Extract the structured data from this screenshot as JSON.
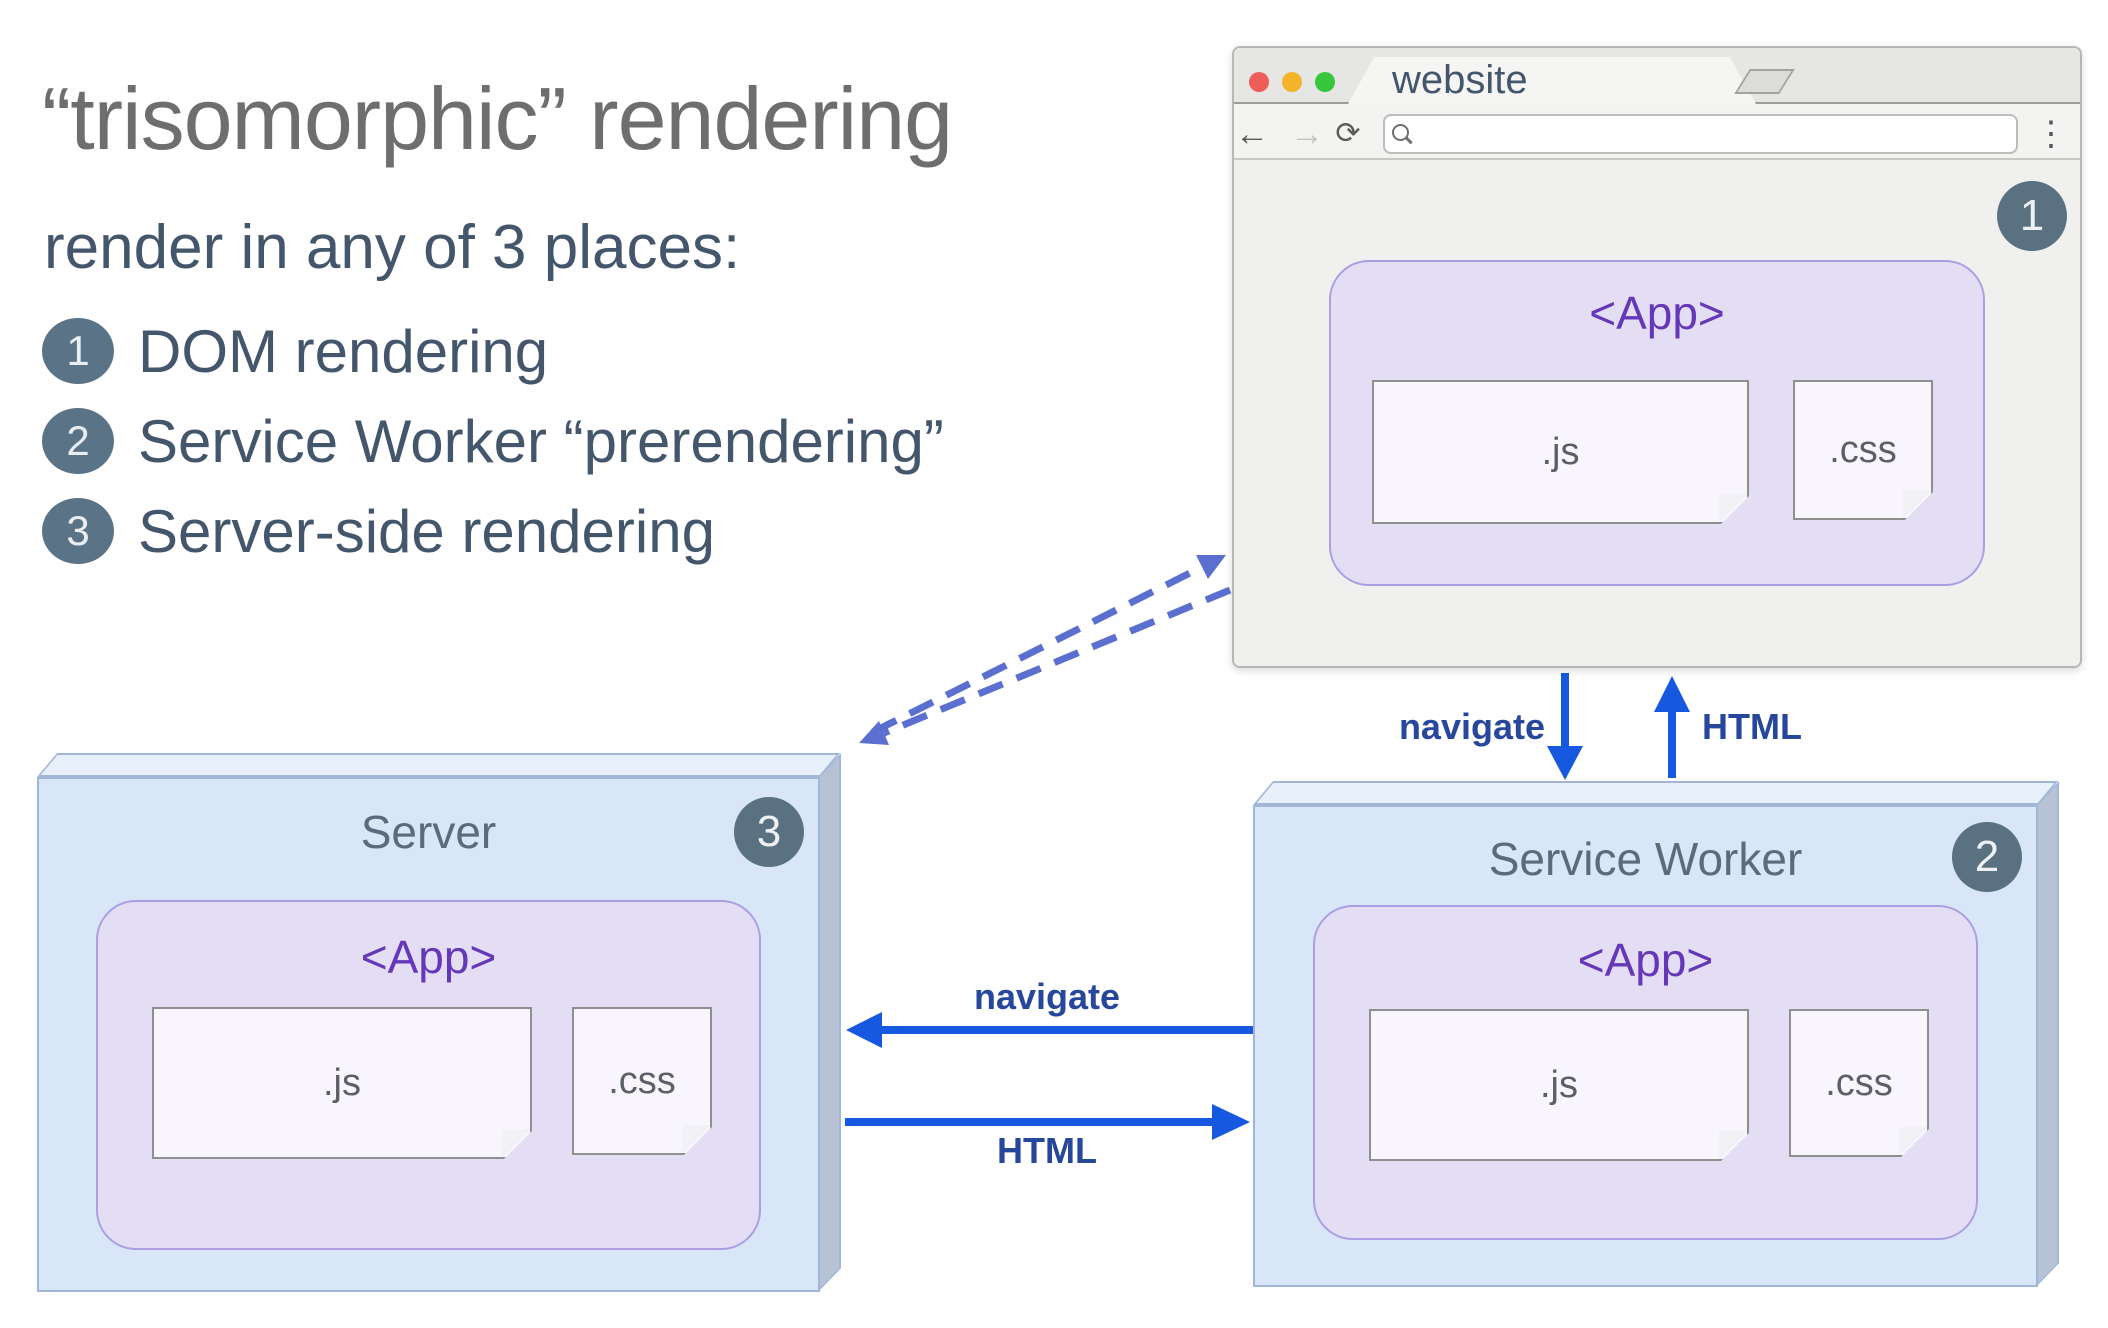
{
  "heading": {
    "title": "“trisomorphic” rendering",
    "subtitle": "render in any of 3 places:",
    "items": [
      {
        "num": "1",
        "label": "DOM rendering"
      },
      {
        "num": "2",
        "label": "Service Worker “prerendering”"
      },
      {
        "num": "3",
        "label": "Server-side rendering"
      }
    ]
  },
  "browser": {
    "tab_title": "website",
    "url_placeholder": "",
    "badge": "1",
    "back_icon": "←",
    "forward_icon": "→",
    "reload_icon": "⟳",
    "menu_icon": "⋮",
    "app": {
      "label": "<App>",
      "files": [
        ".js",
        ".css"
      ]
    }
  },
  "server": {
    "title": "Server",
    "badge": "3",
    "app": {
      "label": "<App>",
      "files": [
        ".js",
        ".css"
      ]
    }
  },
  "service_worker": {
    "title": "Service Worker",
    "badge": "2",
    "app": {
      "label": "<App>",
      "files": [
        ".js",
        ".css"
      ]
    }
  },
  "arrows": {
    "browser_to_sw": "navigate",
    "sw_to_browser": "HTML",
    "sw_to_server": "navigate",
    "server_to_sw": "HTML"
  },
  "colors": {
    "arrow_blue": "#1659e0",
    "arrow_label_navy": "#27479c",
    "dashed_indigo": "#5b6fd0",
    "badge_slate": "#5a7181",
    "list_badge_slate": "#5b7386",
    "app_purple_bg": "#e4def5",
    "app_purple_border": "#ab9ee2",
    "app_text_purple": "#6438b8",
    "box_blue_bg": "#d9e6f8",
    "box_blue_lid": "#e8f0fc",
    "box_blue_side": "#b7c2d5",
    "box_border": "#a2b7d8",
    "title_gray": "#6e6e6e",
    "body_slate": "#44566b",
    "box_title_slate": "#5a6b7c",
    "traffic_red": "#ee5d5a",
    "traffic_yellow": "#f3b32a",
    "traffic_green": "#38c73c"
  }
}
